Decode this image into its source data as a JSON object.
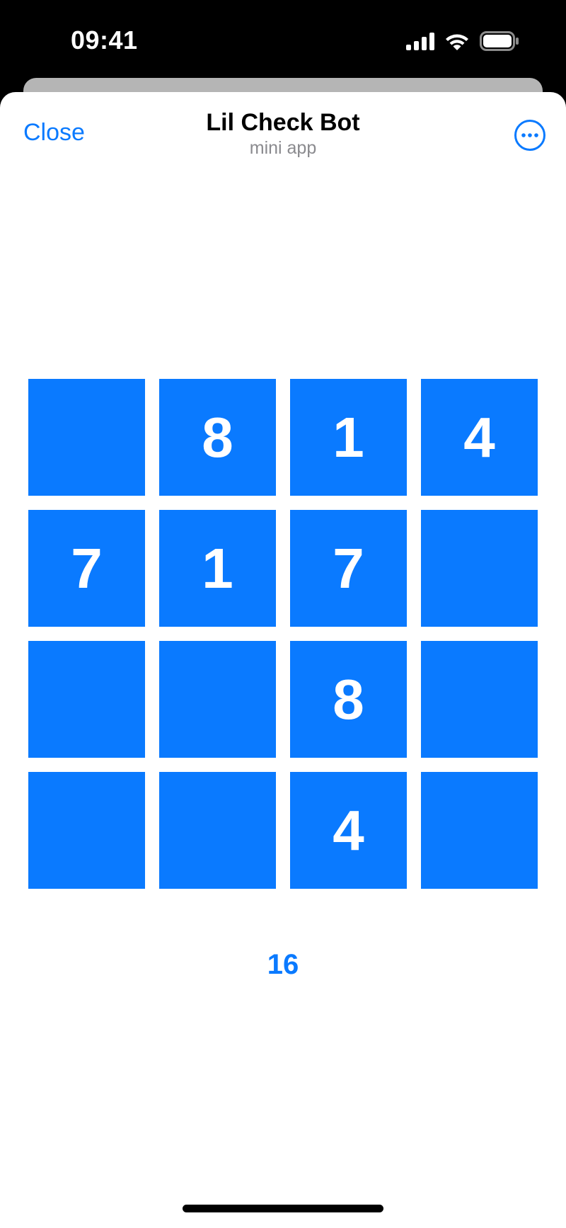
{
  "status_bar": {
    "time": "09:41",
    "icons": [
      "cellular-signal-icon",
      "wifi-icon",
      "battery-icon"
    ]
  },
  "header": {
    "close_label": "Close",
    "title": "Lil Check Bot",
    "subtitle": "mini app",
    "more_icon": "ellipsis-circle-icon"
  },
  "grid": {
    "rows": [
      [
        "",
        "8",
        "1",
        "4"
      ],
      [
        "7",
        "1",
        "7",
        ""
      ],
      [
        "",
        "",
        "8",
        ""
      ],
      [
        "",
        "",
        "4",
        ""
      ]
    ]
  },
  "score": "16",
  "colors": {
    "accent": "#0a7aff",
    "tile": "#0a7aff",
    "tile_text": "#ffffff",
    "background": "#ffffff",
    "subtitle": "#8a8a8e"
  }
}
